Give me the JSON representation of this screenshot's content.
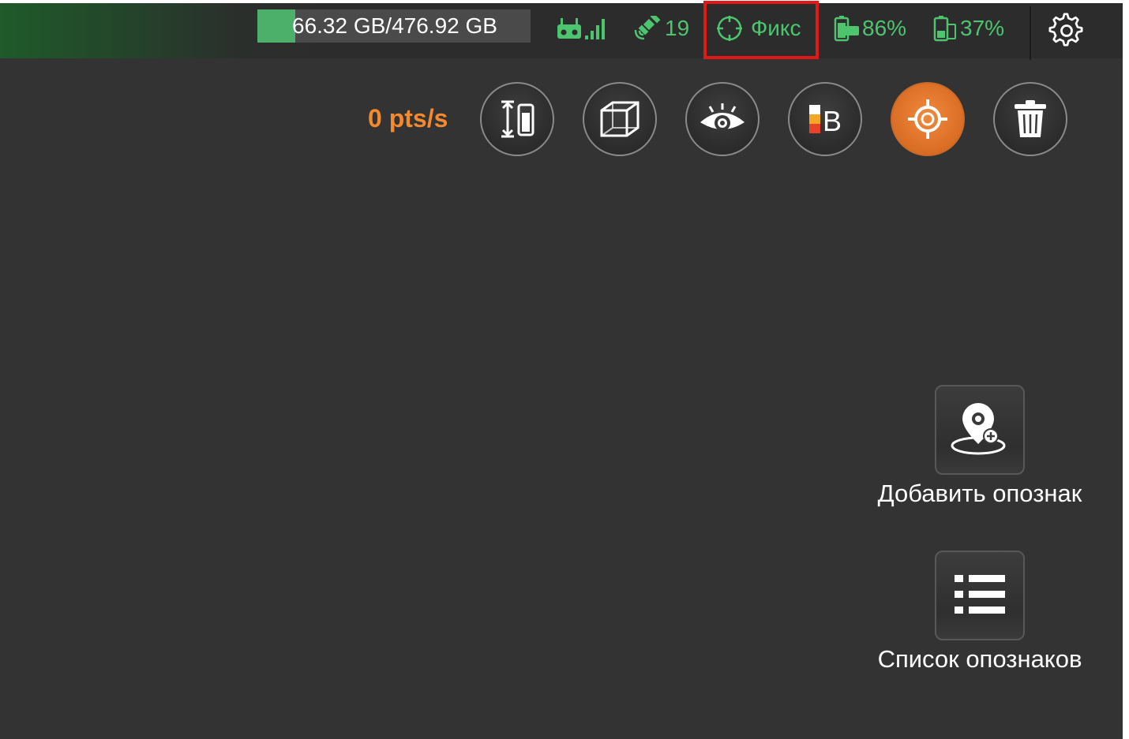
{
  "status_bar": {
    "storage": {
      "text": "66.32 GB/476.92 GB",
      "used_fraction": 0.139
    },
    "satellites": "19",
    "fix_status": "Фикс",
    "controller_battery": "86%",
    "device_battery": "37%",
    "colors": {
      "status_green": "#4cc56e",
      "highlight_red": "#e01818"
    }
  },
  "toolbar": {
    "rate": "0 pts/s",
    "tools": [
      "height-range",
      "3d-box",
      "view",
      "color-bar",
      "locate",
      "delete"
    ],
    "accent": "#f5892e"
  },
  "side_actions": {
    "add_label": "Добавить опознак",
    "list_label": "Список опознаков"
  }
}
